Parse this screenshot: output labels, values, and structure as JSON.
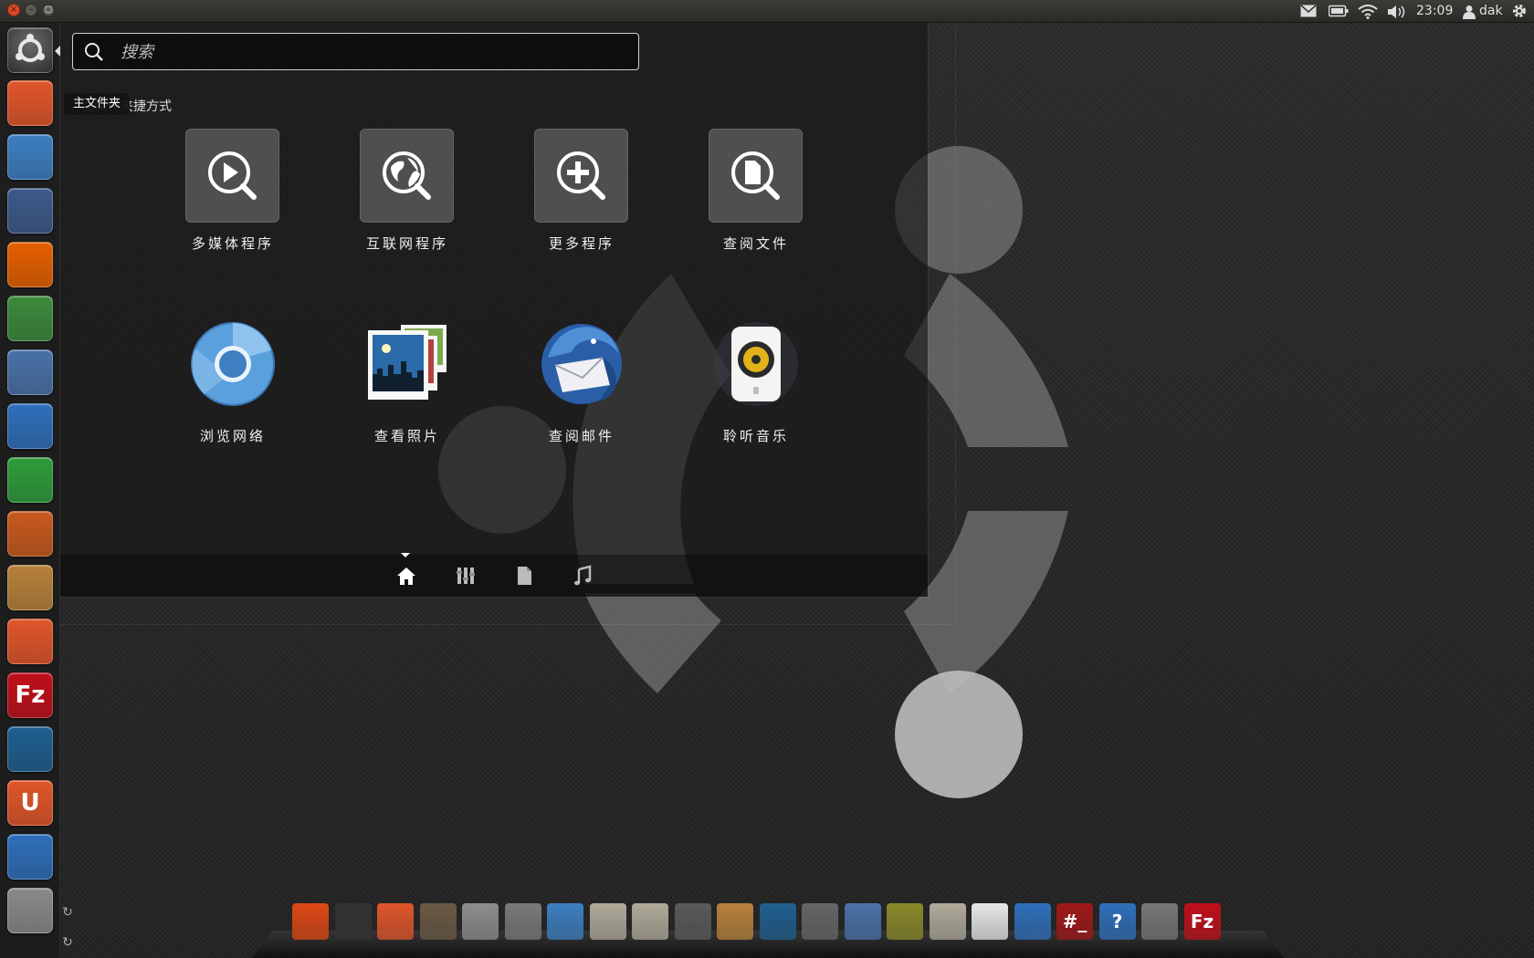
{
  "top_panel": {
    "window_controls": {
      "close": "×",
      "minimize": "–",
      "maximize": "◻"
    },
    "tray_icons": [
      "mail-icon",
      "battery-icon",
      "wifi-icon",
      "volume-icon"
    ],
    "clock": "23:09",
    "user_name": "dak",
    "session_icon": "gear-icon"
  },
  "launcher": {
    "tooltip": "主文件夹",
    "items": [
      {
        "name": "home-folder",
        "glyph": "",
        "color": "#e0562a"
      },
      {
        "name": "chromium",
        "glyph": "",
        "color": "#3d7fc1"
      },
      {
        "name": "network-browser",
        "glyph": "",
        "color": "#3c5a8a"
      },
      {
        "name": "firefox",
        "glyph": "",
        "color": "#e66000"
      },
      {
        "name": "downloader",
        "glyph": "",
        "color": "#3c8a3c"
      },
      {
        "name": "video-editor",
        "glyph": "",
        "color": "#4a72a8"
      },
      {
        "name": "libreoffice-writer",
        "glyph": "",
        "color": "#2f6fba"
      },
      {
        "name": "libreoffice-calc",
        "glyph": "",
        "color": "#2f9c3b"
      },
      {
        "name": "libreoffice-impress",
        "glyph": "",
        "color": "#c85a1f"
      },
      {
        "name": "ubuntu-tweak",
        "glyph": "",
        "color": "#b7823a"
      },
      {
        "name": "software-center",
        "glyph": "",
        "color": "#e0562a"
      },
      {
        "name": "filezilla",
        "glyph": "Fz",
        "color": "#c0101a"
      },
      {
        "name": "monitor-app",
        "glyph": "",
        "color": "#1f5f8f"
      },
      {
        "name": "ubuntu-one",
        "glyph": "U",
        "color": "#e0562a"
      },
      {
        "name": "update-manager",
        "glyph": "",
        "color": "#2f6fba"
      },
      {
        "name": "system-settings",
        "glyph": "",
        "color": "#8a8a8a"
      }
    ]
  },
  "dash": {
    "search": {
      "placeholder": "搜索",
      "value": ""
    },
    "section_label": "主文件夹捷方式",
    "shortcuts": [
      {
        "name": "multimedia",
        "label": "多媒体程序",
        "icon": "play-magnifier-icon"
      },
      {
        "name": "internet",
        "label": "互联网程序",
        "icon": "globe-magnifier-icon"
      },
      {
        "name": "more-apps",
        "label": "更多程序",
        "icon": "plus-magnifier-icon"
      },
      {
        "name": "view-files",
        "label": "查阅文件",
        "icon": "document-magnifier-icon"
      },
      {
        "name": "browse-web",
        "label": "浏览网络",
        "icon": "chromium-icon"
      },
      {
        "name": "view-photos",
        "label": "查看照片",
        "icon": "photos-icon"
      },
      {
        "name": "check-mail",
        "label": "查阅邮件",
        "icon": "thunderbird-icon"
      },
      {
        "name": "listen-music",
        "label": "聆听音乐",
        "icon": "rhythmbox-icon"
      }
    ],
    "lenses": [
      "home-icon",
      "applications-icon",
      "files-icon",
      "music-icon"
    ]
  },
  "dock": {
    "items": [
      {
        "name": "ubuntu-logo",
        "glyph": "",
        "color": "#dd4814"
      },
      {
        "name": "terminal",
        "glyph": "",
        "color": "#333333"
      },
      {
        "name": "software-center",
        "glyph": "",
        "color": "#e0562a"
      },
      {
        "name": "gimp",
        "glyph": "",
        "color": "#6b5a45"
      },
      {
        "name": "file-manager",
        "glyph": "",
        "color": "#8e8e8e"
      },
      {
        "name": "calculator",
        "glyph": "",
        "color": "#7a7a7a"
      },
      {
        "name": "chromium",
        "glyph": "",
        "color": "#3d7fc1"
      },
      {
        "name": "home-folder",
        "glyph": "",
        "color": "#b0ab9a"
      },
      {
        "name": "documents-folder",
        "glyph": "",
        "color": "#b0ab9a"
      },
      {
        "name": "search-tool",
        "glyph": "",
        "color": "#5a5a5a"
      },
      {
        "name": "ubuntu-tweak",
        "glyph": "",
        "color": "#b7823a"
      },
      {
        "name": "monitor-app",
        "glyph": "",
        "color": "#1f5f8f"
      },
      {
        "name": "screenshot",
        "glyph": "",
        "color": "#666666"
      },
      {
        "name": "video-editor",
        "glyph": "",
        "color": "#4a72a8"
      },
      {
        "name": "image-viewer",
        "glyph": "",
        "color": "#8a8a2a"
      },
      {
        "name": "folder",
        "glyph": "",
        "color": "#b0ab9a"
      },
      {
        "name": "phone-sync",
        "glyph": "",
        "color": "#e8e8e8"
      },
      {
        "name": "virtualbox",
        "glyph": "",
        "color": "#2f6fba"
      },
      {
        "name": "remote-terminal",
        "glyph": "#_",
        "color": "#a01818"
      },
      {
        "name": "help",
        "glyph": "?",
        "color": "#2f6fba"
      },
      {
        "name": "sound",
        "glyph": "",
        "color": "#777777"
      },
      {
        "name": "filezilla",
        "glyph": "Fz",
        "color": "#c0101a"
      }
    ]
  },
  "colors": {
    "accent": "#dd4814",
    "panel": "#3c3b37"
  }
}
